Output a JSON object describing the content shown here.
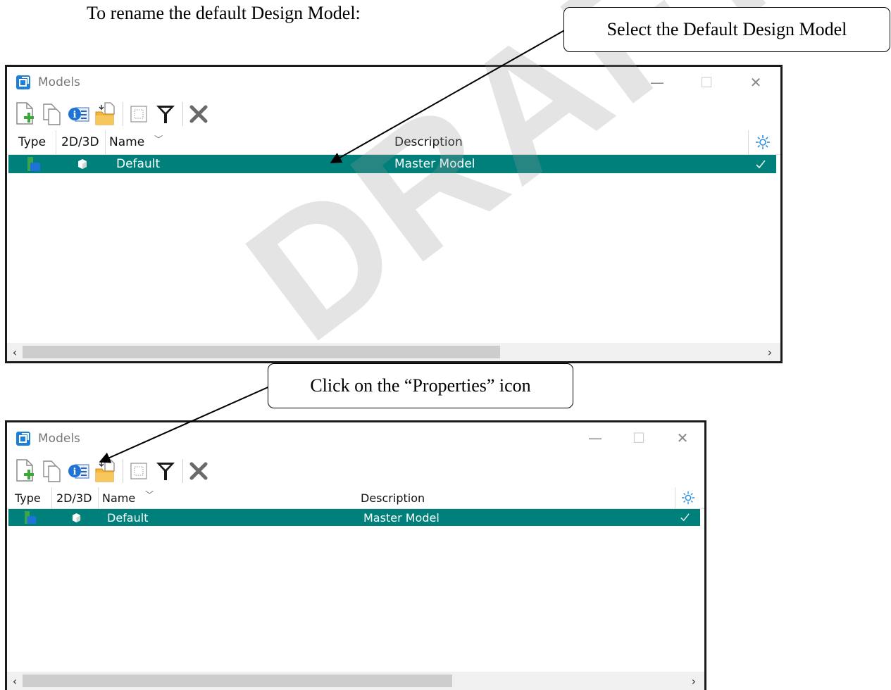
{
  "instruction": "To rename the default Design Model:",
  "callouts": {
    "select": "Select the Default Design Model",
    "properties": "Click on the “Properties” icon"
  },
  "watermark": "DRAFT",
  "window": {
    "title": "Models",
    "minimize": "—",
    "maximize": "☐",
    "close": "✕",
    "columns": {
      "type": "Type",
      "dim": "2D/3D",
      "name": "Name",
      "description": "Description"
    },
    "rows": [
      {
        "name": "Default",
        "description": "Master Model"
      }
    ],
    "scroll_left": "‹",
    "scroll_right": "›"
  },
  "colors": {
    "selection": "#00807a",
    "window_border": "#1a1a1a",
    "watermark": "#969696"
  },
  "icons": [
    "models-app-icon",
    "new-model-icon",
    "copy-model-icon",
    "properties-icon",
    "import-model-icon",
    "select-all-icon",
    "filter-icon",
    "delete-icon",
    "display-options-icon",
    "type-icon",
    "3d-model-icon",
    "active-check-icon",
    "sort-arrow-icon"
  ]
}
